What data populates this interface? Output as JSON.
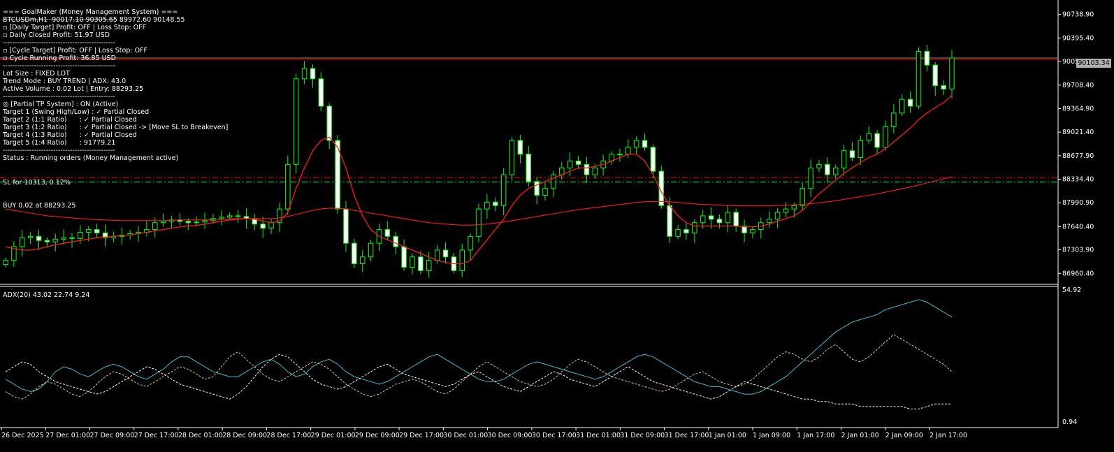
{
  "header": {
    "symbol_line": "BTCUSDm,H1  90017.10 90305.65 89972.60 90148.55"
  },
  "ea_panel": {
    "lines": [
      "=== GoalMaker (Money Management System) ===",
      "-----------------------------------------------",
      "▫ [Daily Target] Profit: OFF | Loss Stop: OFF",
      "▫ Daily Closed Profit: 51.97 USD",
      "-----------------------------------------------",
      "▫ [Cycle Target] Profit: OFF | Loss Stop: OFF",
      "▫ Cycle Running Profit: 36.85 USD",
      "-----------------------------------------------",
      "Lot Size : FIXED LOT",
      "Trend Mode : BUY TREND | ADX: 43.0",
      "Active Volume : 0.02 Lot | Entry: 88293.25",
      "-----------------------------------------------",
      "◎ [Partial TP System] : ON (Active)",
      "Target 1 (Swing High/Low) : ✓ Partial Closed",
      "Target 2 (1:1 Ratio)      : ✓ Partial Closed",
      "Target 3 (1:2 Ratio)      : ✓ Partial Closed -> [Move SL to Breakeven]",
      "Target 4 (1:3 Ratio)      : ✓ Partial Closed",
      "Target 5 (1:4 Ratio)      : 91779.21",
      "-----------------------------------------------",
      "Status : Running orders (Money Management active)"
    ],
    "sl_line_label": "SL for 10313, 0.12%",
    "buy_line_label": "BUY 0.02 at 88293.25"
  },
  "colors": {
    "bull": "#00ff00",
    "bear": "#ffffff",
    "ma": "#ff1a1a",
    "sl_line": "#ff0000",
    "buy_line": "#00ff00",
    "adx_main": "#3fbfcf",
    "plus_di": "#d8d26a",
    "minus_di": "#ffffff",
    "grid": "#ffffff"
  },
  "chart_data": {
    "type": "candlestick",
    "current_price_label": "90103.34",
    "price_axis_ticks": [
      "90738.90",
      "90395.40",
      "90051.90",
      "89708.40",
      "89364.90",
      "89021.40",
      "88677.90",
      "88334.40",
      "87990.90",
      "87640.40",
      "87303.90",
      "86960.40"
    ],
    "price_ylim": [
      86800,
      90950
    ],
    "time_axis_ticks": [
      "26 Dec 2025",
      "27 Dec 01:00",
      "27 Dec 09:00",
      "27 Dec 17:00",
      "28 Dec 01:00",
      "28 Dec 09:00",
      "28 Dec 17:00",
      "29 Dec 01:00",
      "29 Dec 09:00",
      "29 Dec 17:00",
      "30 Dec 01:00",
      "30 Dec 09:00",
      "30 Dec 17:00",
      "31 Dec 01:00",
      "31 Dec 09:00",
      "31 Dec 17:00",
      "1 Jan 01:00",
      "1 Jan 09:00",
      "1 Jan 17:00",
      "2 Jan 01:00",
      "2 Jan 09:00",
      "2 Jan 17:00"
    ],
    "horizontal_lines": [
      {
        "name": "sl",
        "price": 88360
      },
      {
        "name": "buy",
        "price": 88293.25
      },
      {
        "name": "current",
        "price": 90103.34
      }
    ],
    "closes": [
      87150,
      87350,
      87480,
      87500,
      87440,
      87420,
      87460,
      87480,
      87470,
      87560,
      87600,
      87550,
      87480,
      87500,
      87520,
      87540,
      87560,
      87600,
      87700,
      87720,
      87740,
      87720,
      87700,
      87710,
      87730,
      87760,
      87780,
      87800,
      87790,
      87760,
      87680,
      87620,
      87700,
      87900,
      88550,
      89800,
      89950,
      89800,
      89400,
      88900,
      87900,
      87400,
      87100,
      87200,
      87400,
      87600,
      87500,
      87350,
      87050,
      87200,
      87000,
      87150,
      87300,
      87200,
      87000,
      87300,
      87500,
      87900,
      88000,
      87950,
      88400,
      88900,
      88700,
      88300,
      88100,
      88200,
      88400,
      88500,
      88600,
      88550,
      88400,
      88500,
      88600,
      88700,
      88700,
      88800,
      88900,
      88800,
      88450,
      87950,
      87500,
      87600,
      87550,
      87700,
      87800,
      87750,
      87700,
      87850,
      87650,
      87550,
      87600,
      87700,
      87750,
      87850,
      87900,
      87950,
      88200,
      88500,
      88550,
      88400,
      88500,
      88750,
      88650,
      88900,
      89000,
      88800,
      89100,
      89300,
      89500,
      89400,
      90200,
      90000,
      89700,
      89650,
      90103
    ],
    "ma_fast": [
      87350,
      87320,
      87300,
      87300,
      87320,
      87350,
      87380,
      87400,
      87420,
      87440,
      87460,
      87480,
      87490,
      87500,
      87510,
      87520,
      87540,
      87560,
      87580,
      87600,
      87620,
      87640,
      87650,
      87660,
      87680,
      87700,
      87720,
      87740,
      87750,
      87760,
      87750,
      87720,
      87700,
      87720,
      87850,
      88200,
      88500,
      88750,
      88900,
      88950,
      88800,
      88500,
      88100,
      87800,
      87600,
      87500,
      87450,
      87400,
      87350,
      87300,
      87250,
      87200,
      87150,
      87120,
      87100,
      87100,
      87150,
      87300,
      87450,
      87600,
      87750,
      87950,
      88100,
      88200,
      88250,
      88300,
      88350,
      88400,
      88450,
      88500,
      88500,
      88520,
      88550,
      88600,
      88650,
      88700,
      88700,
      88600,
      88400,
      88150,
      87950,
      87800,
      87700,
      87650,
      87650,
      87650,
      87650,
      87650,
      87650,
      87640,
      87640,
      87650,
      87680,
      87720,
      87760,
      87800,
      87880,
      88000,
      88120,
      88220,
      88320,
      88420,
      88500,
      88580,
      88650,
      88700,
      88780,
      88880,
      88980,
      89080,
      89200,
      89300,
      89380,
      89450,
      89560
    ],
    "ma_slow": [
      87900,
      87880,
      87860,
      87840,
      87820,
      87800,
      87790,
      87780,
      87770,
      87760,
      87750,
      87745,
      87740,
      87735,
      87730,
      87730,
      87730,
      87730,
      87730,
      87730,
      87735,
      87740,
      87740,
      87740,
      87740,
      87745,
      87750,
      87755,
      87760,
      87760,
      87760,
      87760,
      87760,
      87770,
      87790,
      87820,
      87850,
      87880,
      87900,
      87910,
      87910,
      87900,
      87880,
      87860,
      87840,
      87820,
      87800,
      87780,
      87760,
      87740,
      87720,
      87700,
      87690,
      87680,
      87670,
      87665,
      87665,
      87670,
      87680,
      87695,
      87710,
      87730,
      87750,
      87770,
      87790,
      87810,
      87830,
      87850,
      87870,
      87890,
      87905,
      87920,
      87935,
      87950,
      87965,
      87980,
      87995,
      88005,
      88010,
      88010,
      88005,
      87995,
      87985,
      87975,
      87965,
      87960,
      87955,
      87950,
      87948,
      87946,
      87945,
      87945,
      87947,
      87950,
      87955,
      87960,
      87968,
      87978,
      87990,
      88005,
      88020,
      88040,
      88060,
      88080,
      88100,
      88120,
      88145,
      88170,
      88195,
      88220,
      88250,
      88280,
      88310,
      88340,
      88370
    ],
    "adx_panel": {
      "label": "ADX(20) 43.02 22.74 9.24",
      "ylim": [
        0.94,
        54.92
      ],
      "axis_ticks": [
        "54.92",
        "0.94"
      ],
      "series": [
        {
          "key": "adx",
          "values": [
            19,
            17,
            15,
            14,
            15,
            18,
            22,
            24,
            23,
            21,
            20,
            22,
            24,
            25,
            24,
            22,
            20,
            19,
            21,
            23,
            26,
            28,
            28,
            26,
            24,
            22,
            21,
            20,
            20,
            22,
            24,
            26,
            27,
            25,
            22,
            20,
            21,
            24,
            26,
            27,
            25,
            22,
            20,
            19,
            18,
            17,
            18,
            20,
            22,
            24,
            26,
            28,
            29,
            27,
            25,
            23,
            21,
            19,
            18,
            18,
            19,
            21,
            23,
            25,
            26,
            25,
            24,
            23,
            22,
            21,
            20,
            19,
            20,
            22,
            24,
            26,
            28,
            29,
            28,
            26,
            24,
            22,
            20,
            18,
            17,
            16,
            16,
            15,
            14,
            13,
            13,
            14,
            16,
            18,
            20,
            23,
            26,
            29,
            32,
            35,
            38,
            40,
            42,
            43,
            44,
            45,
            47,
            48,
            49,
            50,
            51,
            50,
            48,
            46,
            44
          ]
        },
        {
          "key": "plus_di",
          "values": [
            14,
            12,
            11,
            13,
            16,
            18,
            17,
            15,
            13,
            12,
            14,
            17,
            20,
            22,
            21,
            19,
            17,
            16,
            18,
            20,
            22,
            24,
            23,
            21,
            19,
            20,
            24,
            28,
            30,
            27,
            24,
            21,
            19,
            18,
            20,
            22,
            24,
            26,
            25,
            23,
            20,
            17,
            15,
            13,
            12,
            13,
            15,
            17,
            18,
            19,
            18,
            16,
            14,
            13,
            15,
            18,
            21,
            24,
            26,
            24,
            22,
            20,
            18,
            17,
            16,
            17,
            19,
            22,
            25,
            27,
            26,
            24,
            22,
            20,
            19,
            18,
            17,
            16,
            15,
            14,
            15,
            17,
            19,
            21,
            22,
            20,
            18,
            17,
            16,
            17,
            19,
            22,
            25,
            28,
            30,
            29,
            27,
            26,
            28,
            31,
            33,
            30,
            27,
            26,
            28,
            31,
            34,
            37,
            35,
            33,
            31,
            29,
            27,
            25,
            22
          ]
        },
        {
          "key": "minus_di",
          "values": [
            22,
            24,
            26,
            25,
            22,
            20,
            18,
            17,
            16,
            15,
            14,
            13,
            14,
            16,
            18,
            20,
            22,
            24,
            23,
            21,
            19,
            17,
            16,
            15,
            14,
            13,
            12,
            11,
            13,
            16,
            20,
            24,
            27,
            29,
            28,
            25,
            22,
            19,
            17,
            16,
            15,
            16,
            18,
            20,
            22,
            24,
            25,
            23,
            21,
            20,
            19,
            18,
            17,
            16,
            17,
            19,
            21,
            22,
            20,
            18,
            16,
            15,
            14,
            16,
            18,
            20,
            22,
            21,
            19,
            18,
            17,
            16,
            18,
            20,
            22,
            24,
            22,
            20,
            18,
            17,
            16,
            15,
            14,
            13,
            12,
            11,
            12,
            14,
            16,
            18,
            17,
            16,
            15,
            14,
            13,
            12,
            11,
            11,
            10,
            10,
            9,
            9,
            9,
            8,
            8,
            8,
            8,
            8,
            8,
            7,
            7,
            8,
            9,
            9,
            9
          ]
        }
      ]
    }
  }
}
